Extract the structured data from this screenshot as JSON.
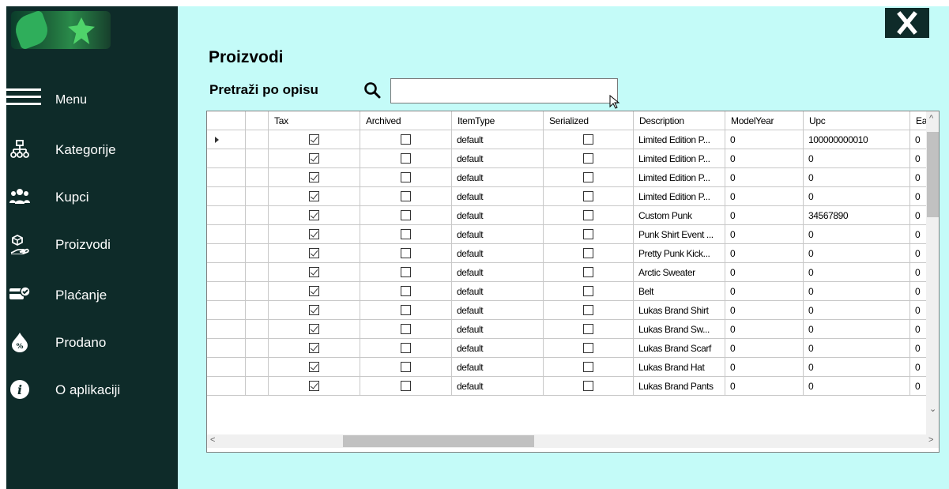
{
  "sidebar": {
    "menu_label": "Menu",
    "items": [
      {
        "label": "Kategorije",
        "icon": "sitemap-icon"
      },
      {
        "label": "Kupci",
        "icon": "users-icon"
      },
      {
        "label": "Proizvodi",
        "icon": "hand-box-icon"
      },
      {
        "label": "Plaćanje",
        "icon": "payment-check-icon"
      },
      {
        "label": "Prodano",
        "icon": "discount-drop-icon"
      },
      {
        "label": "O aplikaciji",
        "icon": "info-icon"
      }
    ]
  },
  "main": {
    "title": "Proizvodi",
    "search_label": "Pretraži po opisu",
    "search_value": ""
  },
  "grid": {
    "columns": [
      "",
      "",
      "Tax",
      "Archived",
      "ItemType",
      "Serialized",
      "Description",
      "ModelYear",
      "Upc",
      "Ea"
    ],
    "rows": [
      {
        "tax": true,
        "archived": false,
        "item_type": "default",
        "serialized": false,
        "description": "Limited Edition P...",
        "model_year": "0",
        "upc": "100000000010",
        "ea": "0"
      },
      {
        "tax": true,
        "archived": false,
        "item_type": "default",
        "serialized": false,
        "description": "Limited Edition P...",
        "model_year": "0",
        "upc": "0",
        "ea": "0"
      },
      {
        "tax": true,
        "archived": false,
        "item_type": "default",
        "serialized": false,
        "description": "Limited Edition P...",
        "model_year": "0",
        "upc": "0",
        "ea": "0"
      },
      {
        "tax": true,
        "archived": false,
        "item_type": "default",
        "serialized": false,
        "description": "Limited Edition P...",
        "model_year": "0",
        "upc": "0",
        "ea": "0"
      },
      {
        "tax": true,
        "archived": false,
        "item_type": "default",
        "serialized": false,
        "description": "Custom Punk",
        "model_year": "0",
        "upc": "34567890",
        "ea": "0"
      },
      {
        "tax": true,
        "archived": false,
        "item_type": "default",
        "serialized": false,
        "description": "Punk Shirt Event ...",
        "model_year": "0",
        "upc": "0",
        "ea": "0"
      },
      {
        "tax": true,
        "archived": false,
        "item_type": "default",
        "serialized": false,
        "description": "Pretty Punk Kick...",
        "model_year": "0",
        "upc": "0",
        "ea": "0"
      },
      {
        "tax": true,
        "archived": false,
        "item_type": "default",
        "serialized": false,
        "description": "Arctic Sweater",
        "model_year": "0",
        "upc": "0",
        "ea": "0"
      },
      {
        "tax": true,
        "archived": false,
        "item_type": "default",
        "serialized": false,
        "description": "Belt",
        "model_year": "0",
        "upc": "0",
        "ea": "0"
      },
      {
        "tax": true,
        "archived": false,
        "item_type": "default",
        "serialized": false,
        "description": "Lukas Brand Shirt",
        "model_year": "0",
        "upc": "0",
        "ea": "0"
      },
      {
        "tax": true,
        "archived": false,
        "item_type": "default",
        "serialized": false,
        "description": "Lukas Brand Sw...",
        "model_year": "0",
        "upc": "0",
        "ea": "0"
      },
      {
        "tax": true,
        "archived": false,
        "item_type": "default",
        "serialized": false,
        "description": "Lukas Brand Scarf",
        "model_year": "0",
        "upc": "0",
        "ea": "0"
      },
      {
        "tax": true,
        "archived": false,
        "item_type": "default",
        "serialized": false,
        "description": "Lukas Brand Hat",
        "model_year": "0",
        "upc": "0",
        "ea": "0"
      },
      {
        "tax": true,
        "archived": false,
        "item_type": "default",
        "serialized": false,
        "description": "Lukas Brand Pants",
        "model_year": "0",
        "upc": "0",
        "ea": "0"
      }
    ]
  },
  "colors": {
    "sidebar_bg": "#0e2b29",
    "main_bg": "#c4fbf8",
    "close_bg": "#0e2b29"
  }
}
